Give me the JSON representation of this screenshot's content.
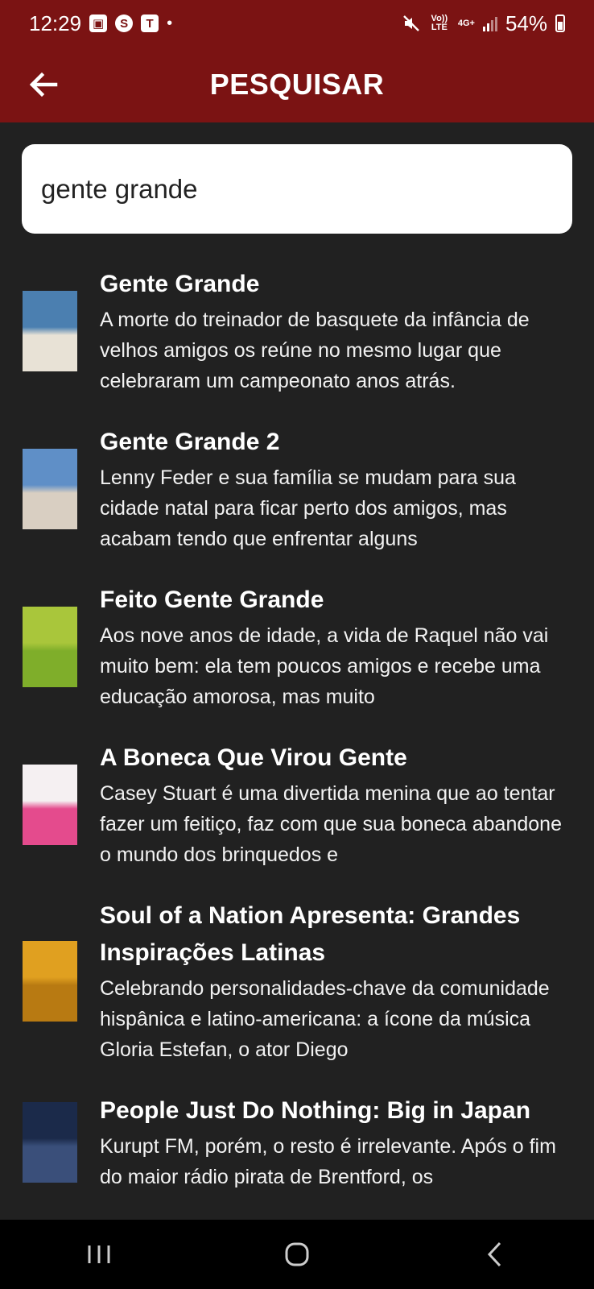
{
  "status_bar": {
    "time": "12:29",
    "left_icons": [
      "gallery-icon",
      "skype-icon",
      "teams-icon",
      "dot"
    ],
    "volte": "Vo)) LTE",
    "network": "4G+",
    "battery": "54%"
  },
  "app_bar": {
    "title": "PESQUISAR",
    "back_icon": "arrow-left-icon"
  },
  "search": {
    "value": "gente grande"
  },
  "results": [
    {
      "title": "Gente Grande",
      "description": "A morte do treinador de basquete da infância de velhos amigos os reúne no mesmo lugar que celebraram um campeonato anos atrás.",
      "poster_colors": [
        "#4b7fb0",
        "#e8e2d6"
      ]
    },
    {
      "title": "Gente Grande 2",
      "description": "Lenny Feder e sua família se mudam para sua cidade natal para ficar perto dos amigos, mas acabam tendo que enfrentar alguns",
      "poster_colors": [
        "#5f8fc7",
        "#d9cfc2"
      ]
    },
    {
      "title": "Feito Gente Grande",
      "description": "Aos nove anos de idade, a vida de Raquel não vai muito bem: ela tem poucos amigos e recebe uma educação amorosa, mas muito",
      "poster_colors": [
        "#a9c63b",
        "#7fae2a"
      ]
    },
    {
      "title": "A Boneca Que Virou Gente",
      "description": "Casey Stuart é uma divertida menina que ao tentar fazer um feitiço, faz com que sua boneca abandone o mundo dos brinquedos e",
      "poster_colors": [
        "#f5f0f2",
        "#e44b8d"
      ]
    },
    {
      "title": "Soul of a Nation Apresenta: Grandes Inspirações Latinas",
      "description": "Celebrando personalidades-chave da comunidade hispânica e latino-americana: a ícone da música Gloria Estefan, o ator Diego",
      "poster_colors": [
        "#e0a020",
        "#b87a12"
      ]
    },
    {
      "title": "People Just Do Nothing: Big in Japan",
      "description": "Kurupt FM, porém, o resto é irrelevante. Após o fim do maior rádio pirata de Brentford, os",
      "poster_colors": [
        "#1b2a4a",
        "#3a4f7a"
      ]
    }
  ],
  "nav_bar": {
    "recents_icon": "recents-icon",
    "home_icon": "home-icon",
    "back_icon": "nav-back-icon"
  }
}
